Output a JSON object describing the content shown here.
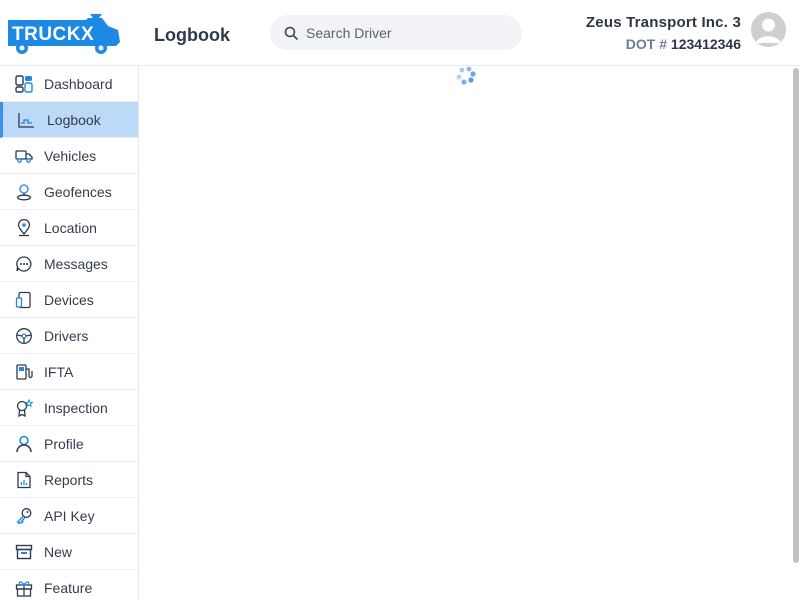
{
  "brand": {
    "logo_text": "TRUCKX",
    "colors": {
      "primary": "#1e88e5",
      "accent": "#3d8ee8",
      "active_bg": "#bcd9f7"
    }
  },
  "header": {
    "page_title": "Logbook",
    "search": {
      "placeholder": "Search Driver",
      "value": ""
    },
    "company_name": "Zeus Transport Inc. 3",
    "dot_label": "DOT #",
    "dot_number": "123412346"
  },
  "sidebar": {
    "items": [
      {
        "label": "Dashboard",
        "icon": "dashboard-icon",
        "active": false
      },
      {
        "label": "Logbook",
        "icon": "logbook-icon",
        "active": true
      },
      {
        "label": "Vehicles",
        "icon": "truck-icon",
        "active": false
      },
      {
        "label": "Geofences",
        "icon": "geofence-pin-icon",
        "active": false
      },
      {
        "label": "Location",
        "icon": "location-pin-icon",
        "active": false
      },
      {
        "label": "Messages",
        "icon": "chat-bubble-icon",
        "active": false
      },
      {
        "label": "Devices",
        "icon": "devices-icon",
        "active": false
      },
      {
        "label": "Drivers",
        "icon": "steering-wheel-icon",
        "active": false
      },
      {
        "label": "IFTA",
        "icon": "fuel-pump-icon",
        "active": false
      },
      {
        "label": "Inspection",
        "icon": "inspection-badge-icon",
        "active": false
      },
      {
        "label": "Profile",
        "icon": "user-icon",
        "active": false
      },
      {
        "label": "Reports",
        "icon": "report-document-icon",
        "active": false
      },
      {
        "label": "API Key",
        "icon": "key-icon",
        "active": false
      },
      {
        "label": "New",
        "icon": "archive-box-icon",
        "active": false
      },
      {
        "label": "Feature",
        "icon": "gift-icon",
        "active": false
      }
    ]
  },
  "main": {
    "loading_indicator": "spinner-icon"
  }
}
